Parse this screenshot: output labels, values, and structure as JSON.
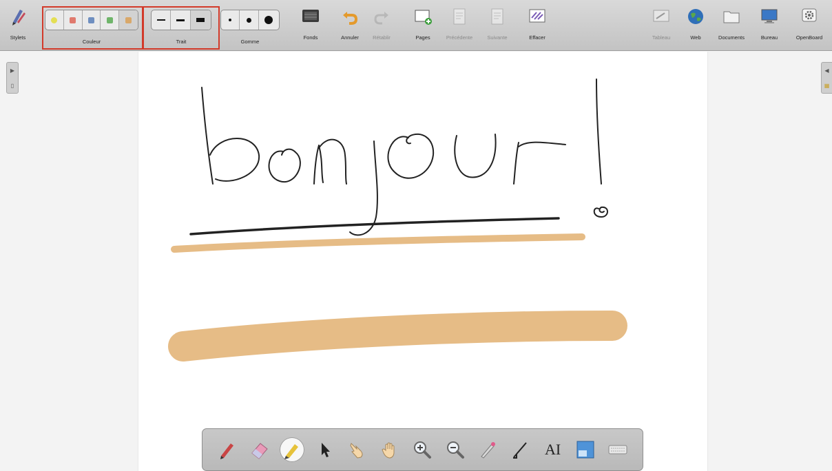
{
  "toolbar": {
    "stylets_label": "Stylets",
    "color_group_label": "Couleur",
    "stroke_group_label": "Trait",
    "eraser_group_label": "Gomme",
    "backgrounds_label": "Fonds",
    "undo_label": "Annuler",
    "redo_label": "Rétablir",
    "pages_label": "Pages",
    "previous_label": "Précédente",
    "next_label": "Suivante",
    "erase_label": "Effacer",
    "board_label": "Tableau",
    "web_label": "Web",
    "documents_label": "Documents",
    "desktop_label": "Bureau",
    "openboard_label": "OpenBoard",
    "colors": [
      "#e4df54",
      "#e07a6e",
      "#6f8fc0",
      "#6fb56a",
      "#d9a86a"
    ],
    "selected_color": "#d9a86a",
    "stroke_widths": [
      "thin",
      "medium",
      "thick"
    ],
    "selected_stroke": "thick",
    "eraser_sizes": [
      "small",
      "medium",
      "large"
    ]
  },
  "board": {
    "handwritten_text": "bonjour !",
    "ink_colors": {
      "pen": "#222222",
      "highlight": "#e6bc86"
    }
  },
  "bottom_palette": {
    "tools": [
      {
        "name": "pen",
        "icon": "pen-icon"
      },
      {
        "name": "eraser",
        "icon": "eraser-icon"
      },
      {
        "name": "highlighter",
        "icon": "highlighter-icon",
        "active": true
      },
      {
        "name": "selector",
        "icon": "arrow-pointer-icon"
      },
      {
        "name": "interact",
        "icon": "pointing-hand-icon"
      },
      {
        "name": "hand",
        "icon": "open-hand-icon"
      },
      {
        "name": "zoom-in",
        "icon": "zoom-in-icon"
      },
      {
        "name": "zoom-out",
        "icon": "zoom-out-icon"
      },
      {
        "name": "laser",
        "icon": "laser-pointer-icon"
      },
      {
        "name": "line",
        "icon": "line-tool-icon"
      },
      {
        "name": "text",
        "icon": "text-tool-icon",
        "text": "AI"
      },
      {
        "name": "capture",
        "icon": "capture-icon"
      },
      {
        "name": "virtual-keyboard",
        "icon": "keyboard-icon"
      }
    ]
  }
}
